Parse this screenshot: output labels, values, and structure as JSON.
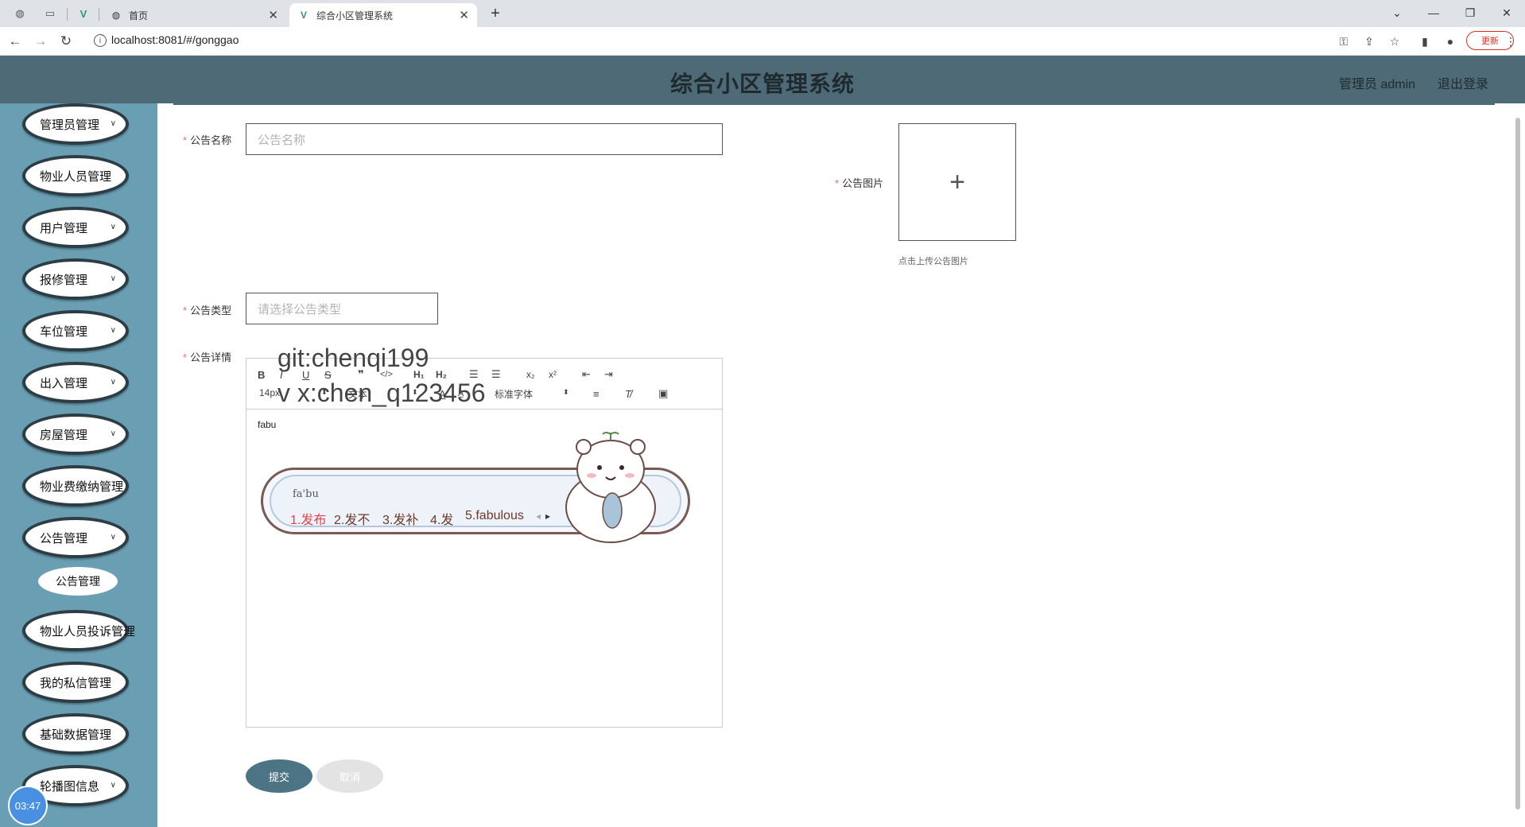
{
  "browser": {
    "tabs": [
      {
        "title": "首页",
        "active": false
      },
      {
        "title": "综合小区管理系统",
        "active": true
      }
    ],
    "new_tab": "+",
    "url": "localhost:8081/#/gonggao",
    "update_label": "更新"
  },
  "header": {
    "title": "综合小区管理系统",
    "user_label": "管理员 admin",
    "logout_label": "退出登录"
  },
  "sidebar": {
    "items": [
      {
        "label": "管理员管理",
        "has_children": true
      },
      {
        "label": "物业人员管理",
        "has_children": false
      },
      {
        "label": "用户管理",
        "has_children": true
      },
      {
        "label": "报修管理",
        "has_children": true
      },
      {
        "label": "车位管理",
        "has_children": true
      },
      {
        "label": "出入管理",
        "has_children": true
      },
      {
        "label": "房屋管理",
        "has_children": true
      },
      {
        "label": "物业费缴纳管理",
        "has_children": false
      },
      {
        "label": "公告管理",
        "has_children": true,
        "expanded": true
      },
      {
        "label": "物业人员投诉管理",
        "has_children": false
      },
      {
        "label": "我的私信管理",
        "has_children": false
      },
      {
        "label": "基础数据管理",
        "has_children": false
      },
      {
        "label": "轮播图信息",
        "has_children": true
      }
    ],
    "submenu": {
      "label": "公告管理"
    },
    "clock": "03:47"
  },
  "form": {
    "name_label": "公告名称",
    "name_placeholder": "公告名称",
    "image_label": "公告图片",
    "image_tip": "点击上传公告图片",
    "type_label": "公告类型",
    "type_placeholder": "请选择公告类型",
    "detail_label": "公告详情",
    "required_mark": "*",
    "editor": {
      "size": "14px",
      "header": "文本",
      "font": "标准字体",
      "content": "fabu"
    },
    "submit_label": "提交",
    "cancel_label": "取消"
  },
  "ime": {
    "pinyin": "fa'bu",
    "candidates": [
      "1.发布",
      "2.发不",
      "3.发补",
      "4.发",
      "5.fabulous"
    ]
  },
  "watermark": {
    "line1": "git:chenqi199",
    "line2": "v x:chen_q123456"
  }
}
